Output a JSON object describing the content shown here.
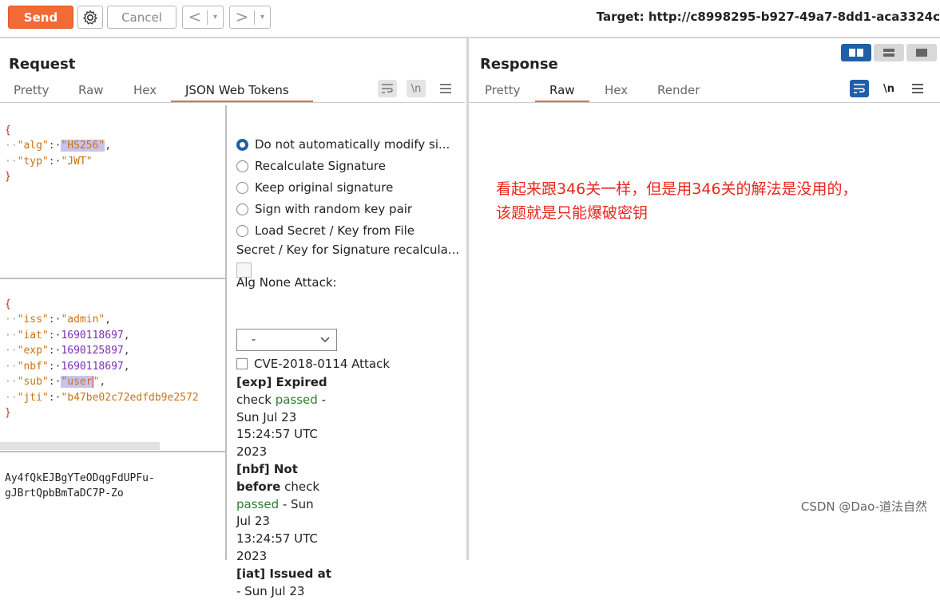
{
  "toolbar": {
    "send_label": "Send",
    "settings_icon": "gear-icon",
    "cancel_label": "Cancel",
    "back_arrow": "<",
    "forward_arrow": ">",
    "dropdown_arrow": "▾",
    "target_label": "Target: http://c8998295-b927-49a7-8dd1-aca3324c"
  },
  "request": {
    "title": "Request",
    "tabs": [
      {
        "label": "Pretty",
        "active": false
      },
      {
        "label": "Raw",
        "active": false
      },
      {
        "label": "Hex",
        "active": false
      },
      {
        "label": "JSON Web Tokens",
        "active": true
      }
    ],
    "header_json": {
      "open": "{",
      "alg_key": "\"alg\"",
      "alg_val": "\"HS256\"",
      "typ_key": "\"typ\"",
      "typ_val": "\"JWT\"",
      "close": "}"
    },
    "payload_json": {
      "open": "{",
      "iss_key": "\"iss\"",
      "iss_val": "\"admin\"",
      "iat_key": "\"iat\"",
      "iat_val": "1690118697",
      "exp_key": "\"exp\"",
      "exp_val": "1690125897",
      "nbf_key": "\"nbf\"",
      "nbf_val": "1690118697",
      "sub_key": "\"sub\"",
      "sub_val_hl": "\"user",
      "sub_val_end": "\"",
      "jti_key": "\"jti\"",
      "jti_val": "\"b47be02c72edfdb9e2572",
      "close": "}"
    },
    "signature": {
      "line1": "Ay4fQkEJBgYTeODqgFdUPFu-",
      "line2": "gJBrtQpbBmTaDC7P-Zo"
    },
    "jwt_options": {
      "radios": [
        {
          "label": "Do not automatically modify si...",
          "selected": true
        },
        {
          "label": "Recalculate Signature",
          "selected": false
        },
        {
          "label": "Keep original signature",
          "selected": false
        },
        {
          "label": "Sign with random key pair",
          "selected": false
        },
        {
          "label": "Load Secret / Key from File",
          "selected": false
        }
      ],
      "secret_label": "Secret / Key for Signature recalcula...",
      "alg_none_label": "Alg None Attack:",
      "alg_none_value": "-",
      "cve_label": "CVE-2018-0114 Attack",
      "exp_title": "[exp] Expired",
      "exp_check": "check",
      "exp_passed": "passed",
      "exp_dash": "-",
      "exp_date1": "Sun Jul 23",
      "exp_date2": "15:24:57 UTC",
      "exp_date3": "2023",
      "nbf_title1": "[nbf] Not",
      "nbf_title2": "before",
      "nbf_check": "check",
      "nbf_passed": "passed",
      "nbf_after": "- Sun",
      "nbf_date1": "Jul 23",
      "nbf_date2": "13:24:57 UTC",
      "nbf_date3": "2023",
      "iat_title": "[iat] Issued at",
      "iat_date1": "- Sun Jul 23"
    }
  },
  "response": {
    "title": "Response",
    "tabs": [
      {
        "label": "Pretty",
        "active": false
      },
      {
        "label": "Raw",
        "active": true
      },
      {
        "label": "Hex",
        "active": false
      },
      {
        "label": "Render",
        "active": false
      }
    ],
    "annotation_line1": "看起来跟346关一样，但是用346关的解法是没用的，",
    "annotation_line2": "该题就是只能爆破密钥"
  },
  "watermark": "CSDN @Dao-道法自然",
  "colors": {
    "accent": "#f26a35",
    "selected_blue": "#1f5fa6",
    "annotation_red": "#e8261e"
  }
}
